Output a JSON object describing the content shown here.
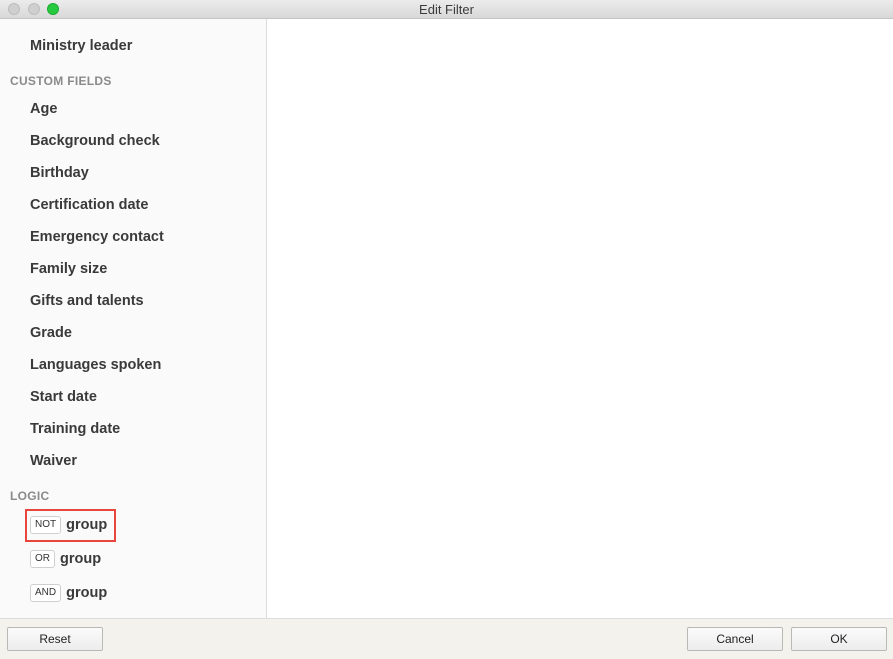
{
  "window": {
    "title": "Edit Filter"
  },
  "sidebar": {
    "top_item": "Ministry leader",
    "custom_fields_header": "CUSTOM FIELDS",
    "custom_fields": [
      "Age",
      "Background check",
      "Birthday",
      "Certification date",
      "Emergency contact",
      "Family size",
      "Gifts and talents",
      "Grade",
      "Languages spoken",
      "Start date",
      "Training date",
      "Waiver"
    ],
    "logic_header": "LOGIC",
    "logic": [
      {
        "operator": "NOT",
        "label": "group"
      },
      {
        "operator": "OR",
        "label": "group"
      },
      {
        "operator": "AND",
        "label": "group"
      }
    ]
  },
  "footer": {
    "reset_label": "Reset",
    "cancel_label": "Cancel",
    "ok_label": "OK"
  },
  "colors": {
    "highlight_border": "#e8453c",
    "zoom_button": "#27c93f"
  }
}
